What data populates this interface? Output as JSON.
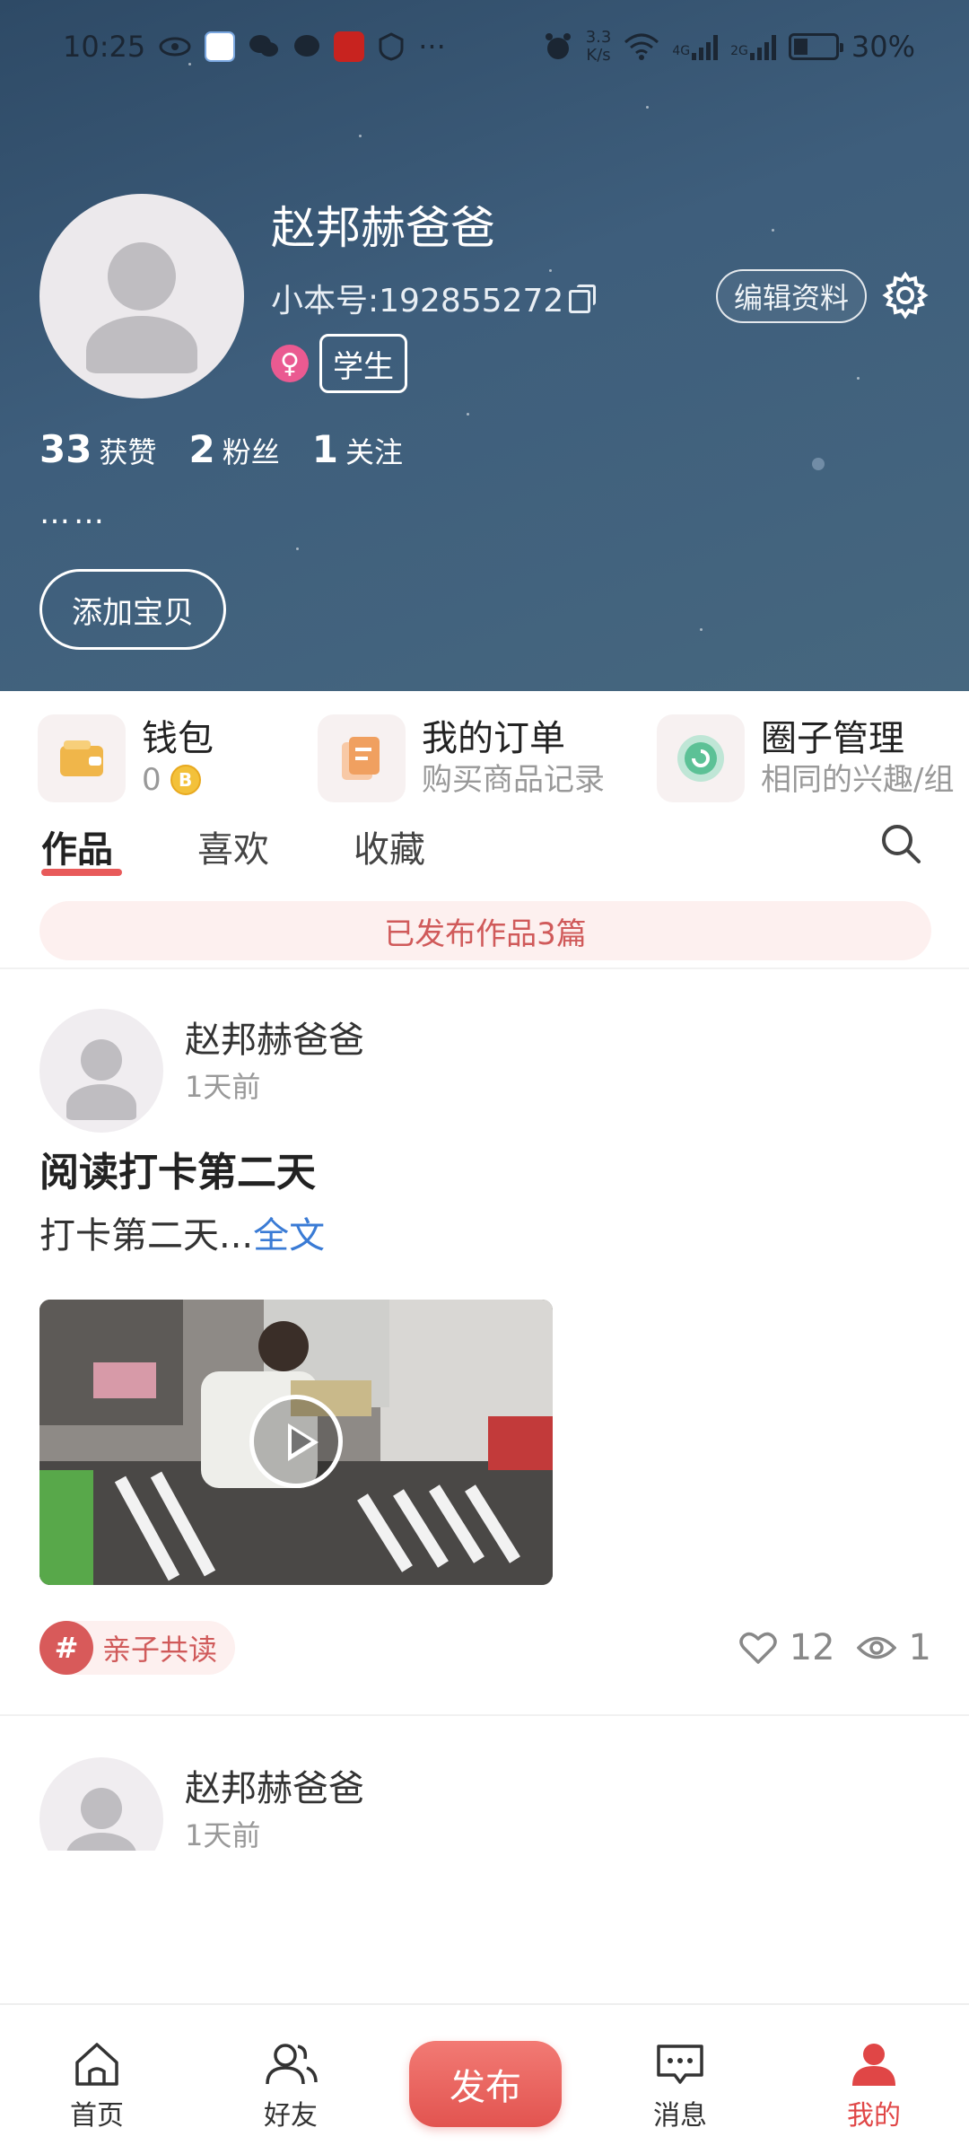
{
  "status_bar": {
    "time": "10:25",
    "more": "···",
    "net_speed_top": "3.3",
    "net_speed_bottom": "K/s",
    "net_4g": "4G",
    "net_2g": "2G",
    "battery": "30%"
  },
  "profile": {
    "username": "赵邦赫爸爸",
    "uid": "小本号:192855272",
    "gender_symbol": "♀",
    "role": "学生",
    "edit_label": "编辑资料",
    "bio": "……",
    "add_baby_label": "添加宝贝",
    "stats": [
      {
        "num": "33",
        "label": "获赞"
      },
      {
        "num": "2",
        "label": "粉丝"
      },
      {
        "num": "1",
        "label": "关注"
      }
    ]
  },
  "quick_entries": [
    {
      "title": "钱包",
      "sub": "0"
    },
    {
      "title": "我的订单",
      "sub": "购买商品记录"
    },
    {
      "title": "圈子管理",
      "sub": "相同的兴趣/组"
    }
  ],
  "tabs": [
    "作品",
    "喜欢",
    "收藏"
  ],
  "published_text": "已发布作品3篇",
  "posts": [
    {
      "author": "赵邦赫爸爸",
      "time": "1天前",
      "title": "阅读打卡第二天",
      "text": "打卡第二天...",
      "more_label": "全文",
      "topic": "亲子共读",
      "topic_hash": "#",
      "likes": "12",
      "views": "1"
    },
    {
      "author": "赵邦赫爸爸",
      "time": "1天前"
    }
  ],
  "bottom_nav": {
    "home": "首页",
    "friends": "好友",
    "publish": "发布",
    "messages": "消息",
    "mine": "我的"
  },
  "colors": {
    "accent": "#e25450",
    "header_bg": "#3e5e7c",
    "link": "#3a7bd5"
  }
}
